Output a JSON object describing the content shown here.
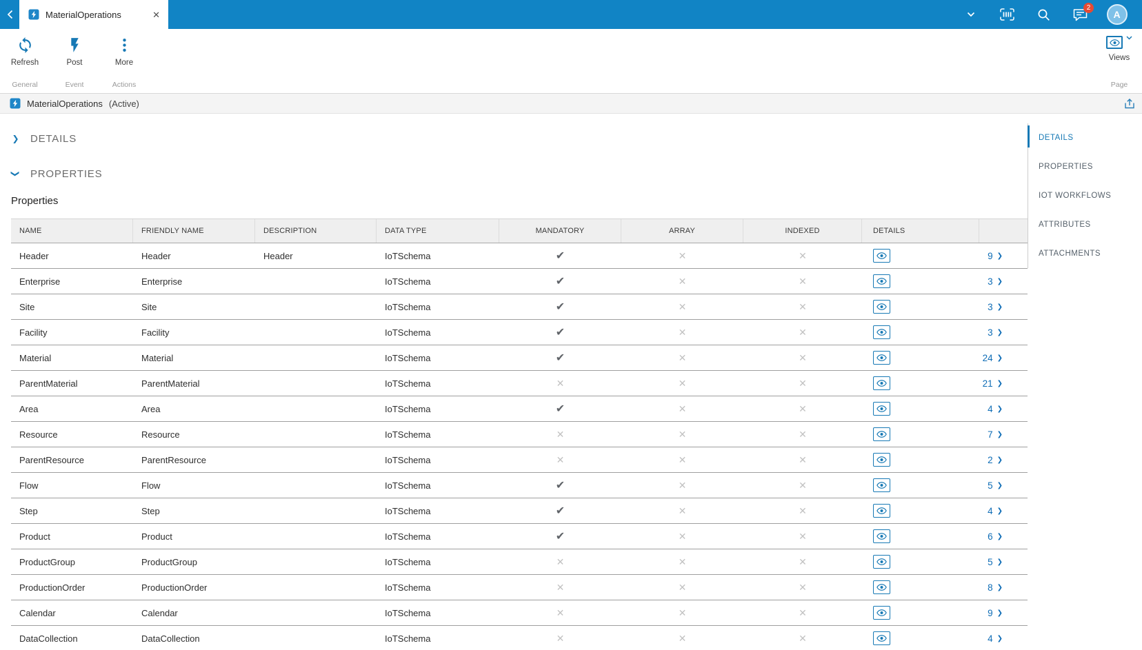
{
  "colors": {
    "topbar_blue": "#1184c5",
    "accent_blue": "#1779b5",
    "link_blue": "#0f6db6",
    "badge_red": "#e64a33",
    "check_gray": "#5f6368",
    "cross_gray": "#c2c2c2"
  },
  "icons": {
    "check": "✔",
    "cross": "✕",
    "close": "✕",
    "chevron_right": "❯"
  },
  "topbar": {
    "tab": {
      "title": "MaterialOperations"
    },
    "chat_badge": "2",
    "avatar_initial": "A"
  },
  "ribbon": {
    "buttons": [
      {
        "label": "Refresh",
        "icon": "refresh-icon",
        "group": "General"
      },
      {
        "label": "Post",
        "icon": "lightning-icon",
        "group": "Event"
      },
      {
        "label": "More",
        "icon": "more-dots-icon",
        "group": "Actions"
      }
    ],
    "views": {
      "label": "Views",
      "icon": "eye-icon",
      "caption": "Page"
    }
  },
  "titlebar": {
    "title": "MaterialOperations",
    "status": "(Active)"
  },
  "sections": {
    "details": {
      "label": "DETAILS",
      "collapsed": true
    },
    "properties": {
      "label": "PROPERTIES",
      "collapsed": false,
      "heading": "Properties"
    }
  },
  "right_nav": {
    "items": [
      {
        "label": "DETAILS",
        "active": true
      },
      {
        "label": "PROPERTIES",
        "active": false
      },
      {
        "label": "IOT WORKFLOWS",
        "active": false
      },
      {
        "label": "ATTRIBUTES",
        "active": false
      },
      {
        "label": "ATTACHMENTS",
        "active": false
      }
    ]
  },
  "table": {
    "columns": [
      "NAME",
      "FRIENDLY NAME",
      "DESCRIPTION",
      "DATA TYPE",
      "MANDATORY",
      "ARRAY",
      "INDEXED",
      "DETAILS"
    ],
    "rows": [
      {
        "name": "Header",
        "friendly_name": "Header",
        "description": "Header",
        "data_type": "IoTSchema",
        "mandatory": true,
        "array": false,
        "indexed": false,
        "details_count": "9"
      },
      {
        "name": "Enterprise",
        "friendly_name": "Enterprise",
        "description": "",
        "data_type": "IoTSchema",
        "mandatory": true,
        "array": false,
        "indexed": false,
        "details_count": "3"
      },
      {
        "name": "Site",
        "friendly_name": "Site",
        "description": "",
        "data_type": "IoTSchema",
        "mandatory": true,
        "array": false,
        "indexed": false,
        "details_count": "3"
      },
      {
        "name": "Facility",
        "friendly_name": "Facility",
        "description": "",
        "data_type": "IoTSchema",
        "mandatory": true,
        "array": false,
        "indexed": false,
        "details_count": "3"
      },
      {
        "name": "Material",
        "friendly_name": "Material",
        "description": "",
        "data_type": "IoTSchema",
        "mandatory": true,
        "array": false,
        "indexed": false,
        "details_count": "24"
      },
      {
        "name": "ParentMaterial",
        "friendly_name": "ParentMaterial",
        "description": "",
        "data_type": "IoTSchema",
        "mandatory": false,
        "array": false,
        "indexed": false,
        "details_count": "21"
      },
      {
        "name": "Area",
        "friendly_name": "Area",
        "description": "",
        "data_type": "IoTSchema",
        "mandatory": true,
        "array": false,
        "indexed": false,
        "details_count": "4"
      },
      {
        "name": "Resource",
        "friendly_name": "Resource",
        "description": "",
        "data_type": "IoTSchema",
        "mandatory": false,
        "array": false,
        "indexed": false,
        "details_count": "7"
      },
      {
        "name": "ParentResource",
        "friendly_name": "ParentResource",
        "description": "",
        "data_type": "IoTSchema",
        "mandatory": false,
        "array": false,
        "indexed": false,
        "details_count": "2"
      },
      {
        "name": "Flow",
        "friendly_name": "Flow",
        "description": "",
        "data_type": "IoTSchema",
        "mandatory": true,
        "array": false,
        "indexed": false,
        "details_count": "5"
      },
      {
        "name": "Step",
        "friendly_name": "Step",
        "description": "",
        "data_type": "IoTSchema",
        "mandatory": true,
        "array": false,
        "indexed": false,
        "details_count": "4"
      },
      {
        "name": "Product",
        "friendly_name": "Product",
        "description": "",
        "data_type": "IoTSchema",
        "mandatory": true,
        "array": false,
        "indexed": false,
        "details_count": "6"
      },
      {
        "name": "ProductGroup",
        "friendly_name": "ProductGroup",
        "description": "",
        "data_type": "IoTSchema",
        "mandatory": false,
        "array": false,
        "indexed": false,
        "details_count": "5"
      },
      {
        "name": "ProductionOrder",
        "friendly_name": "ProductionOrder",
        "description": "",
        "data_type": "IoTSchema",
        "mandatory": false,
        "array": false,
        "indexed": false,
        "details_count": "8"
      },
      {
        "name": "Calendar",
        "friendly_name": "Calendar",
        "description": "",
        "data_type": "IoTSchema",
        "mandatory": false,
        "array": false,
        "indexed": false,
        "details_count": "9"
      },
      {
        "name": "DataCollection",
        "friendly_name": "DataCollection",
        "description": "",
        "data_type": "IoTSchema",
        "mandatory": false,
        "array": false,
        "indexed": false,
        "details_count": "4"
      }
    ]
  }
}
